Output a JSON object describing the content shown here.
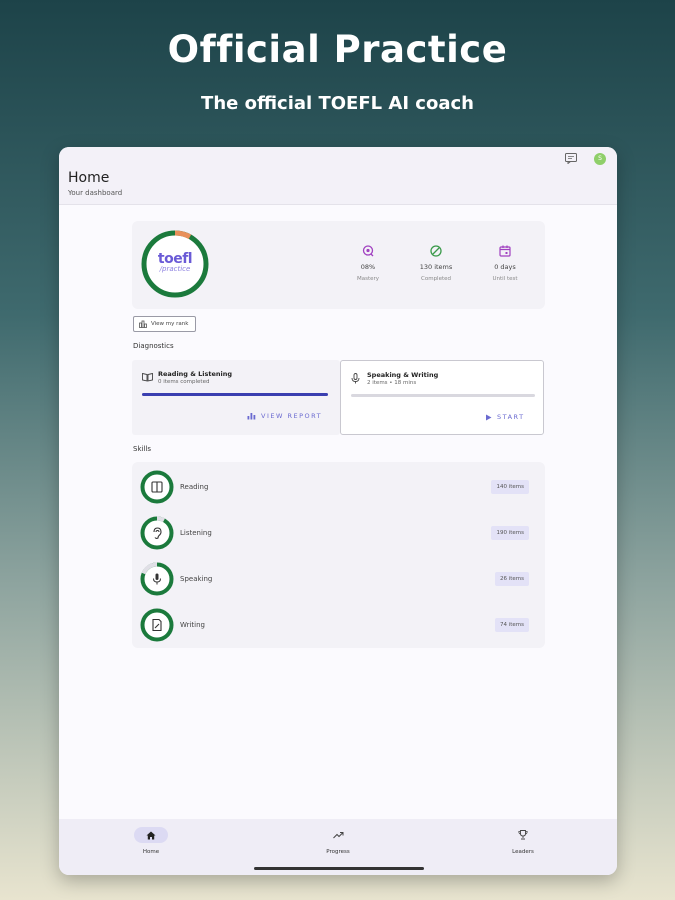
{
  "hero": {
    "title": "Official Practice",
    "subtitle": "The official TOEFL AI coach"
  },
  "appbar": {
    "title": "Home",
    "subtitle": "Your dashboard",
    "avatar_initial": "S"
  },
  "dashboard": {
    "logo_main": "toefl",
    "logo_sub": "/practice",
    "progress_fraction": 0.08,
    "stats": [
      {
        "value": "08%",
        "label": "Mastery",
        "icon": "mastery-icon"
      },
      {
        "value": "130 items",
        "label": "Completed",
        "icon": "check-circle-icon"
      },
      {
        "value": "0 days",
        "label": "Until test",
        "icon": "calendar-icon"
      }
    ],
    "rank_button": "View my rank"
  },
  "diagnostics": {
    "section_label": "Diagnostics",
    "items": [
      {
        "title": "Reading & Listening",
        "subtitle": "0 items completed",
        "action": "VIEW REPORT",
        "progress": 1.0
      },
      {
        "title": "Speaking & Writing",
        "subtitle": "2 items • 18 mins",
        "action": "START",
        "progress": 0.0
      }
    ]
  },
  "skills": {
    "section_label": "Skills",
    "items": [
      {
        "name": "Reading",
        "count": "140 items",
        "icon": "book-icon"
      },
      {
        "name": "Listening",
        "count": "190 items",
        "icon": "ear-icon"
      },
      {
        "name": "Speaking",
        "count": "26 items",
        "icon": "microphone-icon"
      },
      {
        "name": "Writing",
        "count": "74 items",
        "icon": "document-edit-icon"
      }
    ]
  },
  "nav": {
    "items": [
      {
        "label": "Home",
        "icon": "home-icon",
        "active": true
      },
      {
        "label": "Progress",
        "icon": "trend-icon",
        "active": false
      },
      {
        "label": "Leaders",
        "icon": "trophy-icon",
        "active": false
      }
    ]
  },
  "colors": {
    "accent_green": "#1b7a3c",
    "accent_purple": "#6a5ad6",
    "progress_blue": "#3a3fb0"
  }
}
